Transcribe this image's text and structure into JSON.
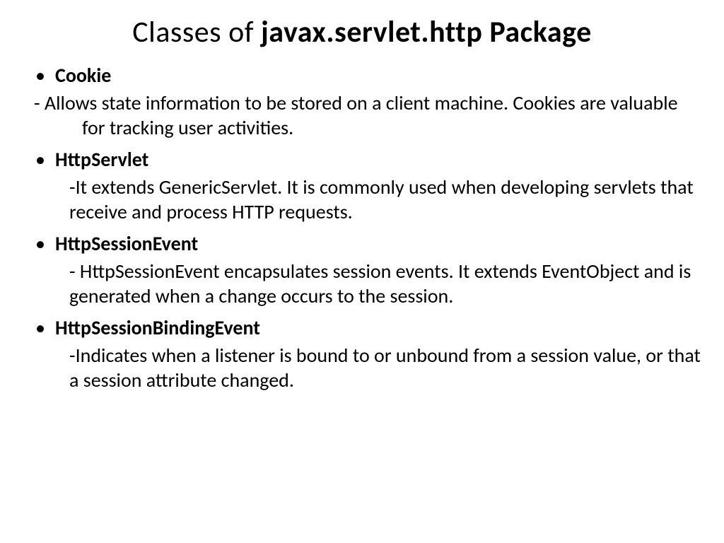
{
  "title": {
    "prefix": "Classes of ",
    "bold": "javax.servlet.http Package"
  },
  "items": [
    {
      "name": "Cookie",
      "desc": "- Allows state information to be stored on a client machine. Cookies are valuable for tracking user activities.",
      "style": "outdent"
    },
    {
      "name": "HttpServlet",
      "desc": "-It extends GenericServlet. It is commonly used when developing servlets that receive and process HTTP requests.",
      "style": "indent"
    },
    {
      "name": "HttpSessionEvent",
      "desc": "- HttpSessionEvent encapsulates session events. It extends EventObject and is generated when a change occurs to the session.",
      "style": "indent"
    },
    {
      "name": "HttpSessionBindingEvent",
      "desc": "-Indicates when a listener is bound to or unbound from a session value, or that a session attribute changed.",
      "style": "indent"
    }
  ]
}
